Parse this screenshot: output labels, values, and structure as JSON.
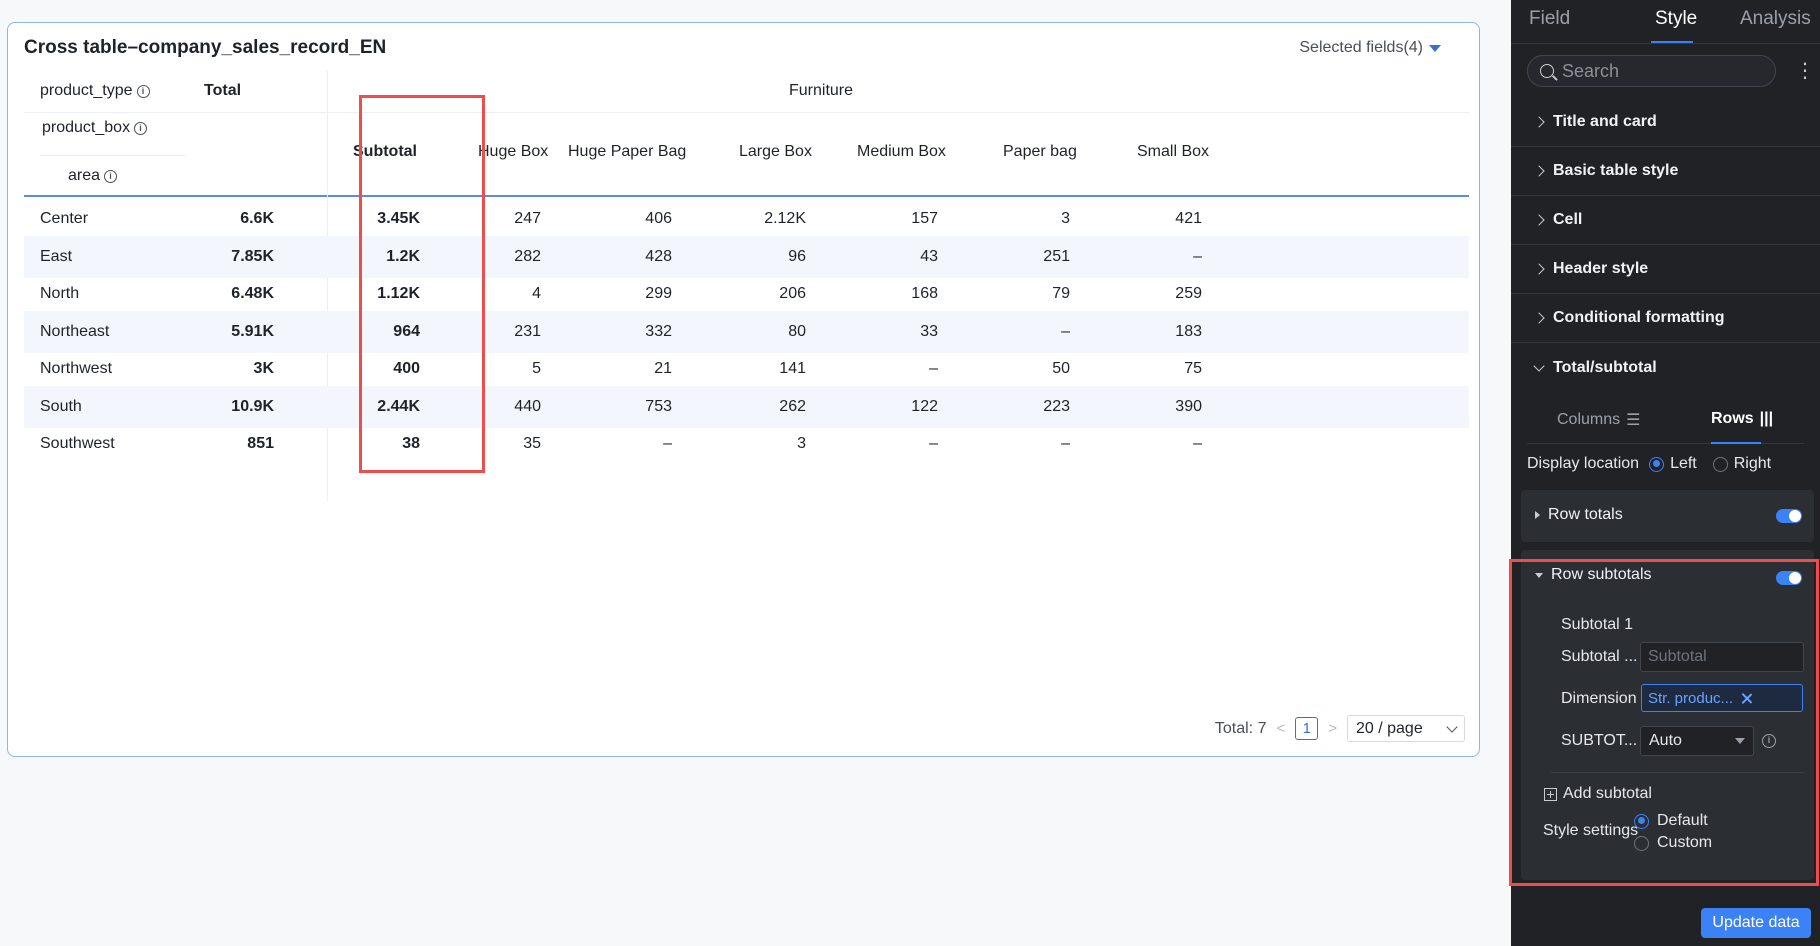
{
  "card": {
    "title": "Cross table–company_sales_record_EN",
    "selected_fields": "Selected fields(4)"
  },
  "table": {
    "row_dim_labels": [
      "product_type",
      "product_box",
      "area"
    ],
    "total_label": "Total",
    "group_label": "Furniture",
    "columns": [
      "Subtotal",
      "Huge Box",
      "Huge Paper Bag",
      "Large Box",
      "Medium Box",
      "Paper bag",
      "Small Box"
    ],
    "rows": [
      {
        "area": "Center",
        "total": "6.6K",
        "values": [
          "3.45K",
          "247",
          "406",
          "2.12K",
          "157",
          "3",
          "421"
        ]
      },
      {
        "area": "East",
        "total": "7.85K",
        "values": [
          "1.2K",
          "282",
          "428",
          "96",
          "43",
          "251",
          "–"
        ]
      },
      {
        "area": "North",
        "total": "6.48K",
        "values": [
          "1.12K",
          "4",
          "299",
          "206",
          "168",
          "79",
          "259"
        ]
      },
      {
        "area": "Northeast",
        "total": "5.91K",
        "values": [
          "964",
          "231",
          "332",
          "80",
          "33",
          "–",
          "183"
        ]
      },
      {
        "area": "Northwest",
        "total": "3K",
        "values": [
          "400",
          "5",
          "21",
          "141",
          "–",
          "50",
          "75"
        ]
      },
      {
        "area": "South",
        "total": "10.9K",
        "values": [
          "2.44K",
          "440",
          "753",
          "262",
          "122",
          "223",
          "390"
        ]
      },
      {
        "area": "Southwest",
        "total": "851",
        "values": [
          "38",
          "35",
          "–",
          "3",
          "–",
          "–",
          "–"
        ]
      }
    ]
  },
  "pager": {
    "total": "Total: 7",
    "current_page": "1",
    "page_size": "20 / page",
    "prev": "<",
    "next": ">"
  },
  "panel": {
    "tabs": [
      "Field",
      "Style",
      "Analysis"
    ],
    "active_tab": "Style",
    "search_placeholder": "Search",
    "kebab": "⋮",
    "sections": [
      "Title and card",
      "Basic table style",
      "Cell",
      "Header style",
      "Conditional formatting",
      "Total/subtotal"
    ],
    "subtabs": {
      "columns": "Columns",
      "rows": "Rows",
      "columns_icon": "☰",
      "rows_icon": "|||"
    },
    "display_location": {
      "label": "Display location",
      "left": "Left",
      "right": "Right",
      "selected": "Left"
    },
    "row_totals": {
      "label": "Row totals",
      "enabled": true
    },
    "row_subtotals": {
      "label": "Row subtotals",
      "enabled": true,
      "subtotal_heading": "Subtotal 1",
      "subtotal_name_label": "Subtotal ...",
      "subtotal_name_placeholder": "Subtotal",
      "dimension_label": "Dimension",
      "dimension_chip": "Str. produc...",
      "subtotal_mode_label": "SUBTOT...",
      "subtotal_mode_value": "Auto",
      "add_subtotal": "Add subtotal",
      "style_settings_label": "Style settings",
      "style_default": "Default",
      "style_custom": "Custom",
      "style_selected": "Default"
    },
    "update_button": "Update data"
  },
  "colors": {
    "accent": "#3b82f6",
    "highlight": "#ee4d4d",
    "panel_bg": "#202226",
    "alt_row": "#f3f6fd"
  },
  "icons": [
    "info-icon",
    "caret-down-icon",
    "search-icon",
    "kebab-icon",
    "chevron-right-icon",
    "chevron-down-icon",
    "close-icon",
    "plus-box-icon"
  ]
}
